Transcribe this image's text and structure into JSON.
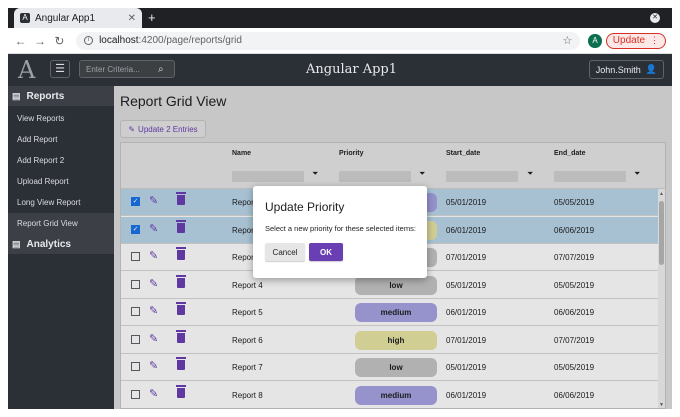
{
  "browser": {
    "tab_title": "Angular App1",
    "tab_favicon": "A",
    "new_tab": "+",
    "url_host": "localhost",
    "url_path": ":4200/page/reports/grid",
    "profile_initial": "A",
    "update_label": "Update"
  },
  "header": {
    "logo": "A",
    "search_placeholder": "Enter Criteria...",
    "app_title": "Angular App1",
    "user_name": "John.Smith"
  },
  "sidebar": {
    "reports_label": "Reports",
    "items": [
      {
        "label": "View Reports"
      },
      {
        "label": "Add Report"
      },
      {
        "label": "Add Report 2"
      },
      {
        "label": "Upload Report"
      },
      {
        "label": "Long View Report"
      },
      {
        "label": "Report Grid View",
        "active": true
      }
    ],
    "analytics_label": "Analytics"
  },
  "main": {
    "page_title": "Report Grid View",
    "update_button": "Update 2 Entries",
    "columns": {
      "name": "Name",
      "priority": "Priority",
      "start": "Start_date",
      "end": "End_date"
    },
    "rows": [
      {
        "name": "Report 2",
        "priority": "medium",
        "start": "05/01/2019",
        "end": "05/05/2019",
        "selected": true
      },
      {
        "name": "Report 3",
        "priority": "high",
        "start": "06/01/2019",
        "end": "06/06/2019",
        "selected": true
      },
      {
        "name": "Report 4",
        "priority": "low",
        "start": "07/01/2019",
        "end": "07/07/2019",
        "selected": false
      },
      {
        "name": "Report 4",
        "priority": "low",
        "start": "05/01/2019",
        "end": "05/05/2019",
        "selected": false
      },
      {
        "name": "Report 5",
        "priority": "medium",
        "start": "06/01/2019",
        "end": "06/06/2019",
        "selected": false
      },
      {
        "name": "Report 6",
        "priority": "high",
        "start": "07/01/2019",
        "end": "07/07/2019",
        "selected": false
      },
      {
        "name": "Report 7",
        "priority": "low",
        "start": "05/01/2019",
        "end": "05/05/2019",
        "selected": false
      },
      {
        "name": "Report 8",
        "priority": "medium",
        "start": "06/01/2019",
        "end": "06/06/2019",
        "selected": false
      }
    ]
  },
  "dialog": {
    "title": "Update Priority",
    "message": "Select a new priority for these selected items:",
    "cancel": "Cancel",
    "ok": "OK"
  },
  "colors": {
    "accent": "#6a3fb4",
    "selected_row": "#bcd7ea",
    "priority_low": "#c6c6c6",
    "priority_medium": "#a6a3e4",
    "priority_high": "#e9e6a4"
  },
  "icons": {
    "edit": "pencil-icon",
    "delete": "trash-icon",
    "filter": "funnel-icon",
    "search": "search-icon",
    "user": "user-icon",
    "menu": "hamburger-icon"
  }
}
